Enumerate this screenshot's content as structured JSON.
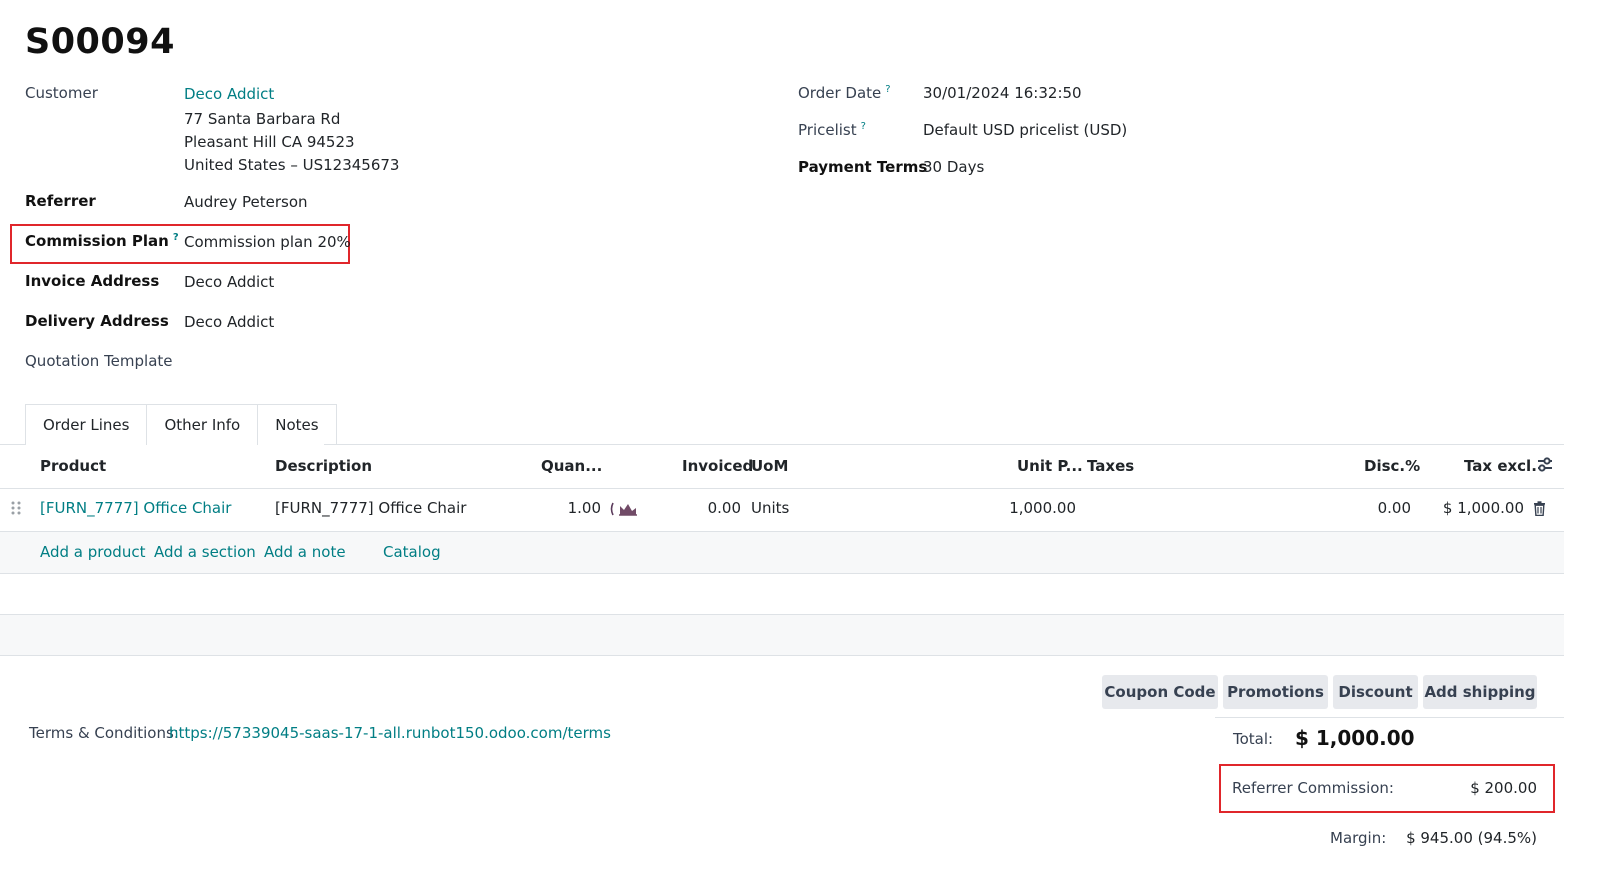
{
  "order": {
    "name": "S00094"
  },
  "left_fields": {
    "customer": {
      "label": "Customer",
      "name": "Deco Addict",
      "street": "77 Santa Barbara Rd",
      "city": "Pleasant Hill CA 94523",
      "country": "United States – US12345673"
    },
    "referrer": {
      "label": "Referrer",
      "value": "Audrey Peterson"
    },
    "commission_plan": {
      "label": "Commission Plan",
      "help": "?",
      "value": "Commission plan 20%"
    },
    "invoice_address": {
      "label": "Invoice Address",
      "value": "Deco Addict"
    },
    "delivery_address": {
      "label": "Delivery Address",
      "value": "Deco Addict"
    },
    "quotation_template": {
      "label": "Quotation Template",
      "value": ""
    }
  },
  "right_fields": {
    "order_date": {
      "label": "Order Date",
      "help": "?",
      "value": "30/01/2024 16:32:50"
    },
    "pricelist": {
      "label": "Pricelist",
      "help": "?",
      "value": "Default USD pricelist (USD)"
    },
    "payment_terms": {
      "label": "Payment Terms",
      "value": "30 Days"
    }
  },
  "tabs": [
    {
      "label": "Order Lines",
      "active": true
    },
    {
      "label": "Other Info",
      "active": false
    },
    {
      "label": "Notes",
      "active": false
    }
  ],
  "table": {
    "headers": {
      "product": "Product",
      "description": "Description",
      "quantity": "Quan...",
      "invoiced": "Invoiced",
      "uom": "UoM",
      "unit_price": "Unit P...",
      "taxes": "Taxes",
      "discount": "Disc.%",
      "tax_excl": "Tax excl."
    },
    "rows": [
      {
        "product": "[FURN_7777] Office Chair",
        "description": "[FURN_7777] Office Chair",
        "quantity": "1.00",
        "invoiced": "0.00",
        "uom": "Units",
        "unit_price": "1,000.00",
        "taxes": "",
        "discount": "0.00",
        "subtotal": "$ 1,000.00"
      }
    ],
    "actions": {
      "add_product": "Add a product",
      "add_section": "Add a section",
      "add_note": "Add a note",
      "catalog": "Catalog"
    }
  },
  "buttons": {
    "coupon": "Coupon Code",
    "promotions": "Promotions",
    "discount": "Discount",
    "shipping": "Add shipping"
  },
  "terms": {
    "label": "Terms & Conditions:",
    "url": "https://57339045-saas-17-1-all.runbot150.odoo.com/terms"
  },
  "totals": {
    "total_label": "Total:",
    "total_value": "$ 1,000.00",
    "commission_label": "Referrer Commission:",
    "commission_value": "$ 200.00",
    "margin_label": "Margin:",
    "margin_value": "$ 945.00 (94.5%)"
  },
  "colors": {
    "accent": "#017e84",
    "highlight": "#e0262b"
  }
}
